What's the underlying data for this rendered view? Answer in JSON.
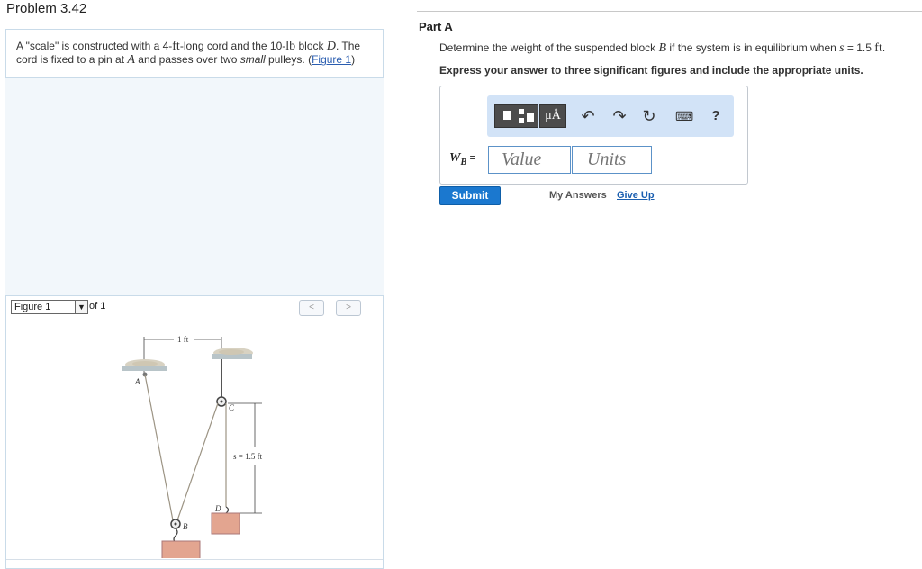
{
  "problem": {
    "title": "Problem 3.42",
    "text_1": "A \"scale\" is constructed with a 4-",
    "text_ft": "ft",
    "text_2": "-long cord and the 10-",
    "text_lb": "lb",
    "text_3": " block ",
    "text_D": "D",
    "text_4": ". The cord is fixed to a pin at ",
    "text_A": "A",
    "text_5": " and passes over two ",
    "text_small": "small",
    "text_6": " pulleys. (",
    "figure_link": "Figure 1",
    "text_7": ")"
  },
  "figure": {
    "select_label": "Figure 1",
    "of_text": "of 1",
    "prev": "<",
    "next": ">",
    "dim_top": "1 ft",
    "label_A": "A",
    "label_C": "C",
    "label_B": "B",
    "label_D": "D",
    "dim_s": "s = 1.5 ft"
  },
  "part": {
    "title": "Part A",
    "question_1": "Determine the weight of the suspended block ",
    "question_B": "B",
    "question_2": " if the system is in equilibrium when ",
    "question_s": "s",
    "question_3": " = 1.5 ",
    "question_ft": "ft",
    "question_4": ".",
    "instruction": "Express your answer to three significant figures and include the appropriate units."
  },
  "toolbar": {
    "units_label": "μÅ",
    "undo_icon": "↶",
    "redo_icon": "↷",
    "reset_icon": "↻",
    "keyboard_icon": "⌨",
    "help_label": "?"
  },
  "answer": {
    "var_main": "W",
    "var_sub": "B",
    "eq": " =",
    "value_placeholder": "Value",
    "units_placeholder": "Units"
  },
  "actions": {
    "submit": "Submit",
    "my_answers": "My Answers",
    "give_up": "Give Up"
  }
}
